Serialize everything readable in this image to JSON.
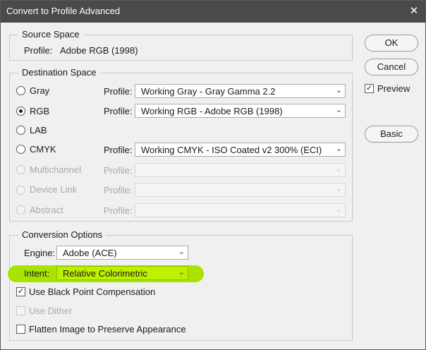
{
  "window": {
    "title": "Convert to Profile Advanced",
    "close_glyph": "✕"
  },
  "source_space": {
    "legend": "Source Space",
    "profile_label": "Profile:",
    "profile_value": "Adobe RGB (1998)"
  },
  "destination_space": {
    "legend": "Destination Space",
    "rows": [
      {
        "label": "Gray",
        "profile_label": "Profile:",
        "profile_value": "Working Gray - Gray Gamma 2.2",
        "selected": false,
        "enabled": true
      },
      {
        "label": "RGB",
        "profile_label": "Profile:",
        "profile_value": "Working RGB - Adobe RGB (1998)",
        "selected": true,
        "enabled": true
      },
      {
        "label": "LAB",
        "profile_label": "",
        "profile_value": "",
        "selected": false,
        "enabled": true
      },
      {
        "label": "CMYK",
        "profile_label": "Profile:",
        "profile_value": "Working CMYK - ISO Coated v2 300% (ECI)",
        "selected": false,
        "enabled": true
      },
      {
        "label": "Multichannel",
        "profile_label": "Profile:",
        "profile_value": "",
        "selected": false,
        "enabled": false
      },
      {
        "label": "Device Link",
        "profile_label": "Profile:",
        "profile_value": "",
        "selected": false,
        "enabled": false
      },
      {
        "label": "Abstract",
        "profile_label": "Profile:",
        "profile_value": "",
        "selected": false,
        "enabled": false
      }
    ]
  },
  "conversion_options": {
    "legend": "Conversion Options",
    "engine_label": "Engine:",
    "engine_value": "Adobe (ACE)",
    "intent_label": "Intent:",
    "intent_value": "Relative Colorimetric",
    "highlight_color": "#a8e400",
    "black_point_label": "Use Black Point Compensation",
    "black_point_checked": true,
    "dither_label": "Use Dither",
    "dither_checked": false,
    "dither_enabled": false,
    "flatten_label": "Flatten Image to Preserve Appearance",
    "flatten_checked": false
  },
  "buttons": {
    "ok": "OK",
    "cancel": "Cancel",
    "preview": "Preview",
    "preview_checked": true,
    "basic": "Basic"
  },
  "icons": {
    "chevron": "⌄",
    "check": "✓"
  }
}
